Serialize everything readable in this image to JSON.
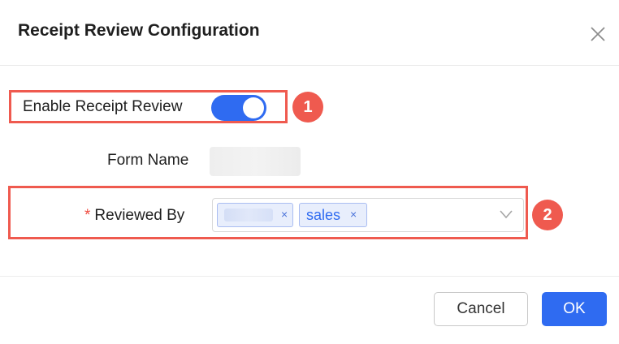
{
  "dialog": {
    "title": "Receipt Review Configuration"
  },
  "form": {
    "enable_label": "Enable Receipt Review",
    "enable_value": true,
    "form_name_label": "Form Name",
    "reviewed_by_required_mark": "*",
    "reviewed_by_label": "Reviewed By",
    "reviewed_by_tags": [
      {
        "label": ""
      },
      {
        "label": "sales"
      }
    ],
    "tag_remove_glyph": "×"
  },
  "annotations": [
    {
      "number": "1"
    },
    {
      "number": "2"
    }
  ],
  "footer": {
    "cancel_label": "Cancel",
    "ok_label": "OK"
  },
  "colors": {
    "accent": "#2f6bf1",
    "highlight": "#ef5a4f",
    "required": "#ef4b3f"
  }
}
